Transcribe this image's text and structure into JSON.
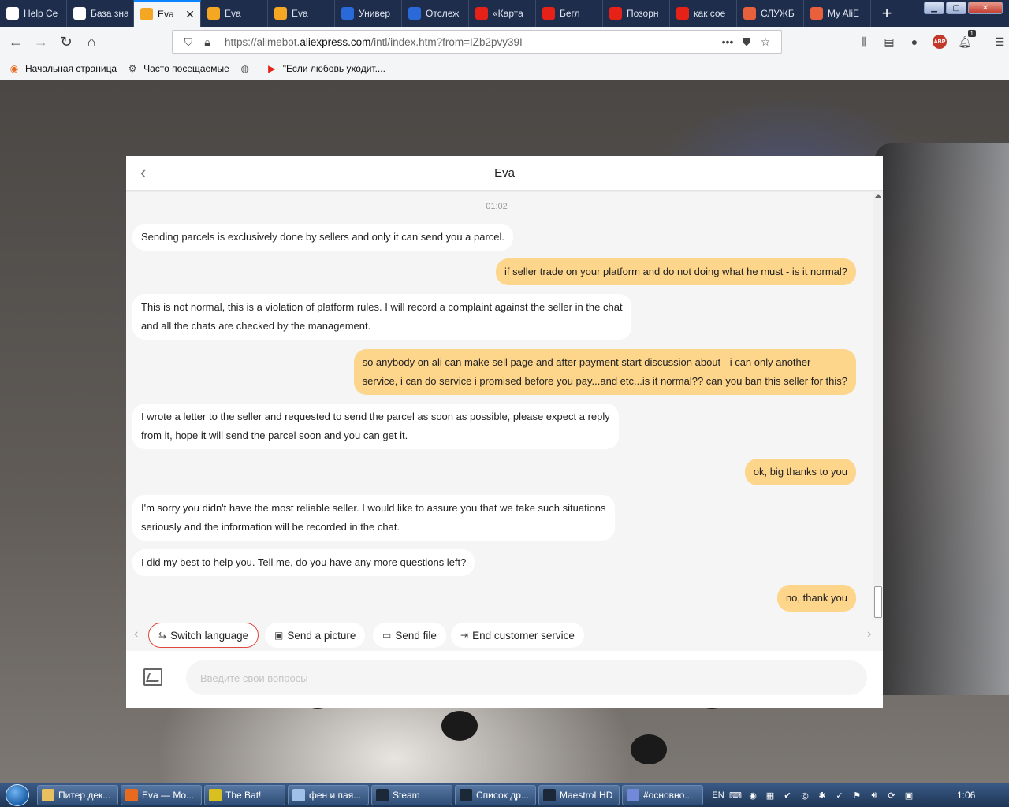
{
  "tabs": [
    {
      "label": "Help Ce",
      "icon": "aliexpress-diamond-icon",
      "color": "#ffffff"
    },
    {
      "label": "База зна",
      "icon": "aliexpress-diamond-icon",
      "color": "#ffffff"
    },
    {
      "label": "Eva",
      "icon": "eva-bot-icon",
      "color": "#f5a623",
      "active": true
    },
    {
      "label": "Eva",
      "icon": "eva-bot-icon",
      "color": "#f5a623"
    },
    {
      "label": "Eva",
      "icon": "eva-bot-icon",
      "color": "#f5a623"
    },
    {
      "label": "Универ",
      "icon": "17track-icon",
      "color": "#2a6ad8"
    },
    {
      "label": "Отслеж",
      "icon": "tracking-icon",
      "color": "#2a6ad8"
    },
    {
      "label": "«Карта",
      "icon": "youtube-icon",
      "color": "#e62117"
    },
    {
      "label": "Бегл",
      "icon": "youtube-icon",
      "color": "#e62117"
    },
    {
      "label": "Позорн",
      "icon": "youtube-icon",
      "color": "#e62117"
    },
    {
      "label": "как сое",
      "icon": "yandex-icon",
      "color": "#e62117"
    },
    {
      "label": "СЛУЖБ",
      "icon": "aliexpress-a-icon",
      "color": "#e8603c"
    },
    {
      "label": "My AliE",
      "icon": "aliexpress-bag-icon",
      "color": "#e8603c"
    }
  ],
  "navbar": {
    "url_prefix": "https://alimebot.",
    "url_domain": "aliexpress.com",
    "url_suffix": "/intl/index.htm?from=IZb2pvy39I",
    "more": "•••",
    "notifications_badge": "1",
    "abp": "ABP"
  },
  "bookmarks": [
    {
      "label": "Начальная страница",
      "icon": "firefox-icon"
    },
    {
      "label": "Часто посещаемые",
      "icon": "gear-icon"
    },
    {
      "label": "",
      "icon": "globe-icon"
    },
    {
      "label": "\"Если любовь уходит....",
      "icon": "youtube-icon"
    }
  ],
  "chat": {
    "title": "Eva",
    "timestamp": "01:02",
    "messages": [
      {
        "from": "bot",
        "lines": [
          "Sending parcels is exclusively done by sellers and only it can send you a parcel."
        ]
      },
      {
        "from": "user",
        "lines": [
          "if seller trade on your platform and do not doing what he must - is it normal?"
        ]
      },
      {
        "from": "bot",
        "lines": [
          "This is not normal, this is a violation of platform rules. I will record a complaint against the seller in the chat",
          "and all the chats are checked by the management."
        ]
      },
      {
        "from": "user",
        "lines": [
          "so anybody on ali can make sell page and after payment start discussion about - i can only another",
          "service, i can do service i promised before you pay...and etc...is it normal?? can you ban this seller for this?"
        ]
      },
      {
        "from": "bot",
        "lines": [
          "I wrote a letter to the seller and requested to send the parcel as soon as possible, please expect a reply",
          "from it, hope it will send the parcel soon and you can get it."
        ]
      },
      {
        "from": "user",
        "lines": [
          "ok, big thanks to you"
        ]
      },
      {
        "from": "bot",
        "lines": [
          "I'm sorry you didn't have the most reliable seller. I would like to assure you that we take such situations",
          "seriously and the information will be recorded in the chat."
        ]
      },
      {
        "from": "bot",
        "lines": [
          "I did my best to help you. Tell me, do you have any more questions left?"
        ]
      },
      {
        "from": "user",
        "lines": [
          "no, thank you"
        ]
      }
    ],
    "quick_actions": {
      "switch_language": "Switch language",
      "send_picture": "Send a picture",
      "send_file": "Send file",
      "end_service": "End customer service"
    },
    "input_placeholder": "Введите свои вопросы",
    "colors": {
      "user_bubble": "#fdd58b",
      "bot_bubble": "#ffffff",
      "accent": "#e0483e"
    }
  },
  "taskbar": {
    "items": [
      {
        "label": "Питер дек...",
        "icon": "folder-icon",
        "color": "#e8c060"
      },
      {
        "label": "Eva — Mo...",
        "icon": "firefox-icon",
        "color": "#e66a1f"
      },
      {
        "label": "The Bat!",
        "icon": "thebat-icon",
        "color": "#d8c020"
      },
      {
        "label": "фен и пая...",
        "icon": "notepad-icon",
        "color": "#a0c0e8"
      },
      {
        "label": "Steam",
        "icon": "steam-icon",
        "color": "#1b2838"
      },
      {
        "label": "Список др...",
        "icon": "steam-icon",
        "color": "#1b2838"
      },
      {
        "label": "MaestroLHD",
        "icon": "steam-icon",
        "color": "#1b2838"
      },
      {
        "label": "#основно...",
        "icon": "discord-icon",
        "color": "#7289da"
      }
    ],
    "lang": "EN",
    "clock": "1:06"
  }
}
